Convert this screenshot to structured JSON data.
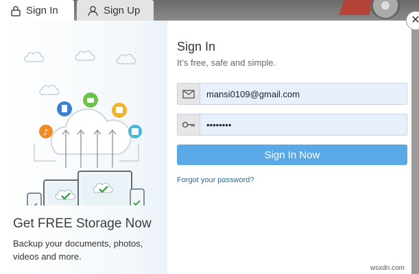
{
  "tabs": {
    "signin_label": "Sign In",
    "signup_label": "Sign Up"
  },
  "promo": {
    "title": "Get FREE Storage Now",
    "text": "Backup your documents, photos, videos and more."
  },
  "form": {
    "title": "Sign In",
    "subtitle": "It’s free, safe and simple.",
    "email_value": "mansi0109@gmail.com",
    "password_value": "••••••••",
    "submit_label": "Sign In Now",
    "forgot_label": "Forgot your password?"
  },
  "close_glyph": "✕",
  "watermark": "wsxdn.com",
  "colors": {
    "accent": "#5aa9e6",
    "link": "#2a6aa3",
    "field_bg": "#e8f0fe"
  },
  "icons": {
    "signin_tab": "lock-icon",
    "signup_tab": "user-icon",
    "email_field": "envelope-icon",
    "password_field": "key-icon"
  }
}
